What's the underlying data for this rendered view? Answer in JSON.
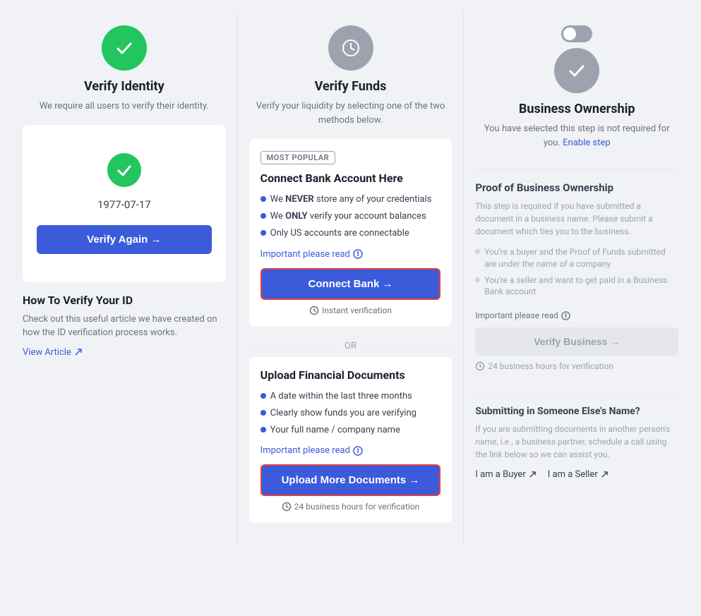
{
  "col1": {
    "icon": "check",
    "icon_color": "green",
    "title": "Verify Identity",
    "subtitle": "We require all users to verify their identity.",
    "card": {
      "date": "1977-07-17",
      "verify_btn": "Verify Again →"
    },
    "how_to": {
      "title": "How To Verify Your ID",
      "desc": "Check out this useful article we have created on how the ID verification process works.",
      "link": "View Article"
    }
  },
  "col2": {
    "icon": "clock",
    "icon_color": "gray",
    "title": "Verify Funds",
    "subtitle": "Verify your liquidity by selecting one of the two methods below.",
    "connect_card": {
      "badge": "MOST POPULAR",
      "title": "Connect Bank Account Here",
      "bullets": [
        {
          "text": "We NEVER store any of your credentials",
          "bold": "NEVER"
        },
        {
          "text": "We ONLY verify your account balances",
          "bold": "ONLY"
        },
        {
          "text": "Only US accounts are connectable"
        }
      ],
      "important_link": "Important please read",
      "btn": "Connect Bank →",
      "instant": "Instant verification"
    },
    "or_label": "OR",
    "upload_card": {
      "title": "Upload Financial Documents",
      "bullets": [
        "A date within the last three months",
        "Clearly show funds you are verifying",
        "Your full name / company name"
      ],
      "important_link": "Important please read",
      "btn": "Upload More Documents →",
      "hours": "24 business hours for verification"
    }
  },
  "col3": {
    "icon": "check",
    "icon_color": "gray",
    "title": "Business Ownership",
    "note_text": "You have selected this step is not required for you.",
    "enable_link": "Enable step",
    "proof_section": {
      "title": "Proof of Business Ownership",
      "desc": "This step is required if you have submitted a document in a business name. Please submit a document which ties you to the business.",
      "bullets": [
        "You're a buyer and the Proof of Funds submitted are under the name of a company",
        "You're a seller and want to get paid in a Business Bank account"
      ],
      "important_link": "Important please read",
      "btn": "Verify Business →",
      "hours": "24 business hours for verification"
    },
    "submitting_section": {
      "title": "Submitting in Someone Else's Name?",
      "desc": "If you are submitting documents in another person's name, i.e., a business partner, schedule a call using the link below so we can assist you.",
      "buyer_link": "I am a Buyer",
      "seller_link": "I am a Seller"
    }
  }
}
